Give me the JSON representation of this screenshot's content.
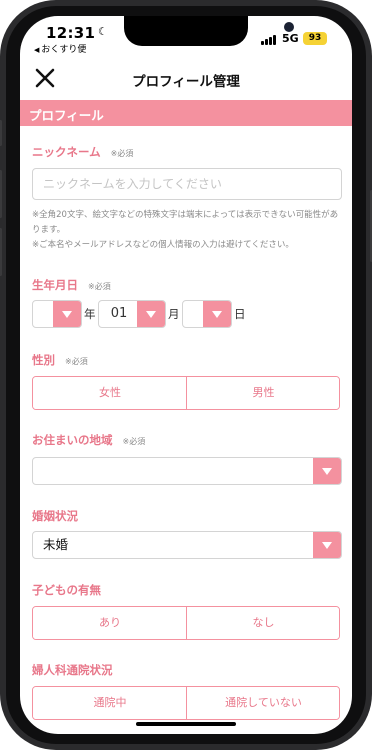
{
  "status": {
    "time": "12:31",
    "back_app": "おくすり便",
    "network": "5G",
    "battery": "93"
  },
  "nav": {
    "title": "プロフィール管理"
  },
  "section": {
    "title": "プロフィール"
  },
  "nickname": {
    "label": "ニックネーム",
    "required": "※必須",
    "value": "",
    "placeholder": "ニックネームを入力してください",
    "note1": "※全角20文字、絵文字などの特殊文字は端末によっては表示できない可能性があります。",
    "note2": "※ご本名やメールアドレスなどの個人情報の入力は避けてください。"
  },
  "birthdate": {
    "label": "生年月日",
    "required": "※必須",
    "year_value": "",
    "year_unit": "年",
    "month_value": "01",
    "month_unit": "月",
    "day_value": "",
    "day_unit": "日"
  },
  "gender": {
    "label": "性別",
    "required": "※必須",
    "options": [
      "女性",
      "男性"
    ]
  },
  "region": {
    "label": "お住まいの地域",
    "required": "※必須",
    "value": ""
  },
  "marital": {
    "label": "婚姻状況",
    "value": "未婚"
  },
  "children": {
    "label": "子どもの有無",
    "options": [
      "あり",
      "なし"
    ]
  },
  "gynecology": {
    "label": "婦人科通院状況",
    "options": [
      "通院中",
      "通院していない"
    ]
  },
  "colors": {
    "accent": "#f4919f",
    "label": "#e8778a",
    "battery": "#f5d235"
  }
}
